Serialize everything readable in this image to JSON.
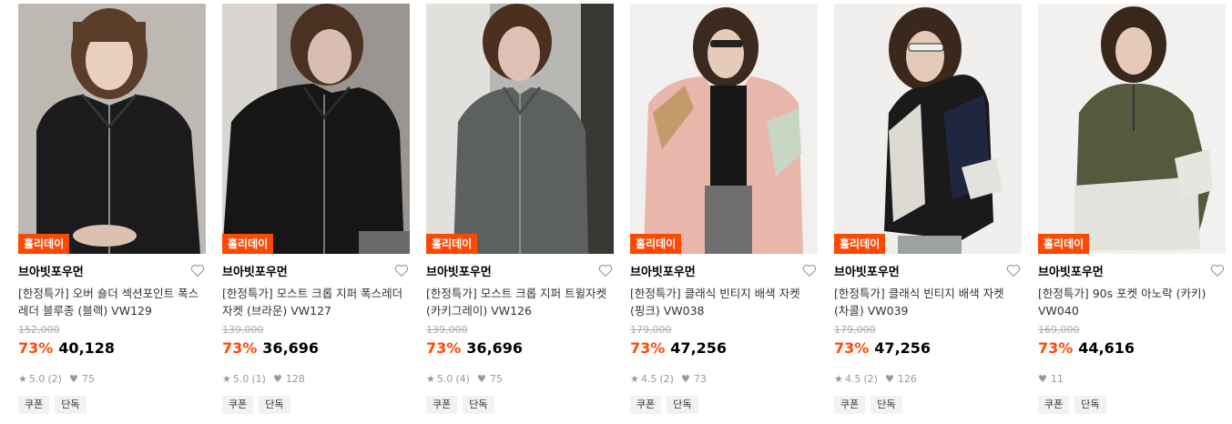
{
  "colors": {
    "badge": "#ff4800",
    "discount": "#ff4800"
  },
  "products": [
    {
      "badge": "홀리데이",
      "brand": "브아빗포우먼",
      "title": "[한정특가] 오버 숄더 섹션포인트 폭스레더 블루종 (블랙) VW129",
      "original_price": "152,000",
      "discount": "73%",
      "price": "40,128",
      "rating": "5.0",
      "reviews": "(2)",
      "likes": "75",
      "tags": [
        "쿠폰",
        "단독"
      ],
      "image": "model-in-black-leather-jacket"
    },
    {
      "badge": "홀리데이",
      "brand": "브아빗포우먼",
      "title": "[한정특가] 모스트 크롭 지퍼 폭스레더 자켓 (브라운) VW127",
      "original_price": "139,000",
      "discount": "73%",
      "price": "36,696",
      "rating": "5.0",
      "reviews": "(1)",
      "likes": "128",
      "tags": [
        "쿠폰",
        "단독"
      ],
      "image": "model-in-dark-leather-jacket"
    },
    {
      "badge": "홀리데이",
      "brand": "브아빗포우먼",
      "title": "[한정특가] 모스트 크롭 지퍼 트윌자켓 (카키그레이) VW126",
      "original_price": "139,000",
      "discount": "73%",
      "price": "36,696",
      "rating": "5.0",
      "reviews": "(4)",
      "likes": "75",
      "tags": [
        "쿠폰",
        "단독"
      ],
      "image": "model-in-grey-twill-jacket"
    },
    {
      "badge": "홀리데이",
      "brand": "브아빗포우먼",
      "title": "[한정특가] 클래식 빈티지 배색 자켓 (핑크) VW038",
      "original_price": "179,000",
      "discount": "73%",
      "price": "47,256",
      "rating": "4.5",
      "reviews": "(2)",
      "likes": "73",
      "tags": [
        "쿠폰",
        "단독"
      ],
      "image": "model-in-pink-windbreaker"
    },
    {
      "badge": "홀리데이",
      "brand": "브아빗포우먼",
      "title": "[한정특가] 클래식 빈티지 배색 자켓 (차콜) VW039",
      "original_price": "179,000",
      "discount": "73%",
      "price": "47,256",
      "rating": "4.5",
      "reviews": "(2)",
      "likes": "126",
      "tags": [
        "쿠폰",
        "단독"
      ],
      "image": "model-in-charcoal-windbreaker"
    },
    {
      "badge": "홀리데이",
      "brand": "브아빗포우먼",
      "title": "[한정특가] 90s 포켓 아노락 (카키) VW040",
      "original_price": "169,000",
      "discount": "73%",
      "price": "44,616",
      "rating": "",
      "reviews": "",
      "likes": "11",
      "tags": [
        "쿠폰",
        "단독"
      ],
      "image": "model-in-khaki-anorak"
    }
  ]
}
